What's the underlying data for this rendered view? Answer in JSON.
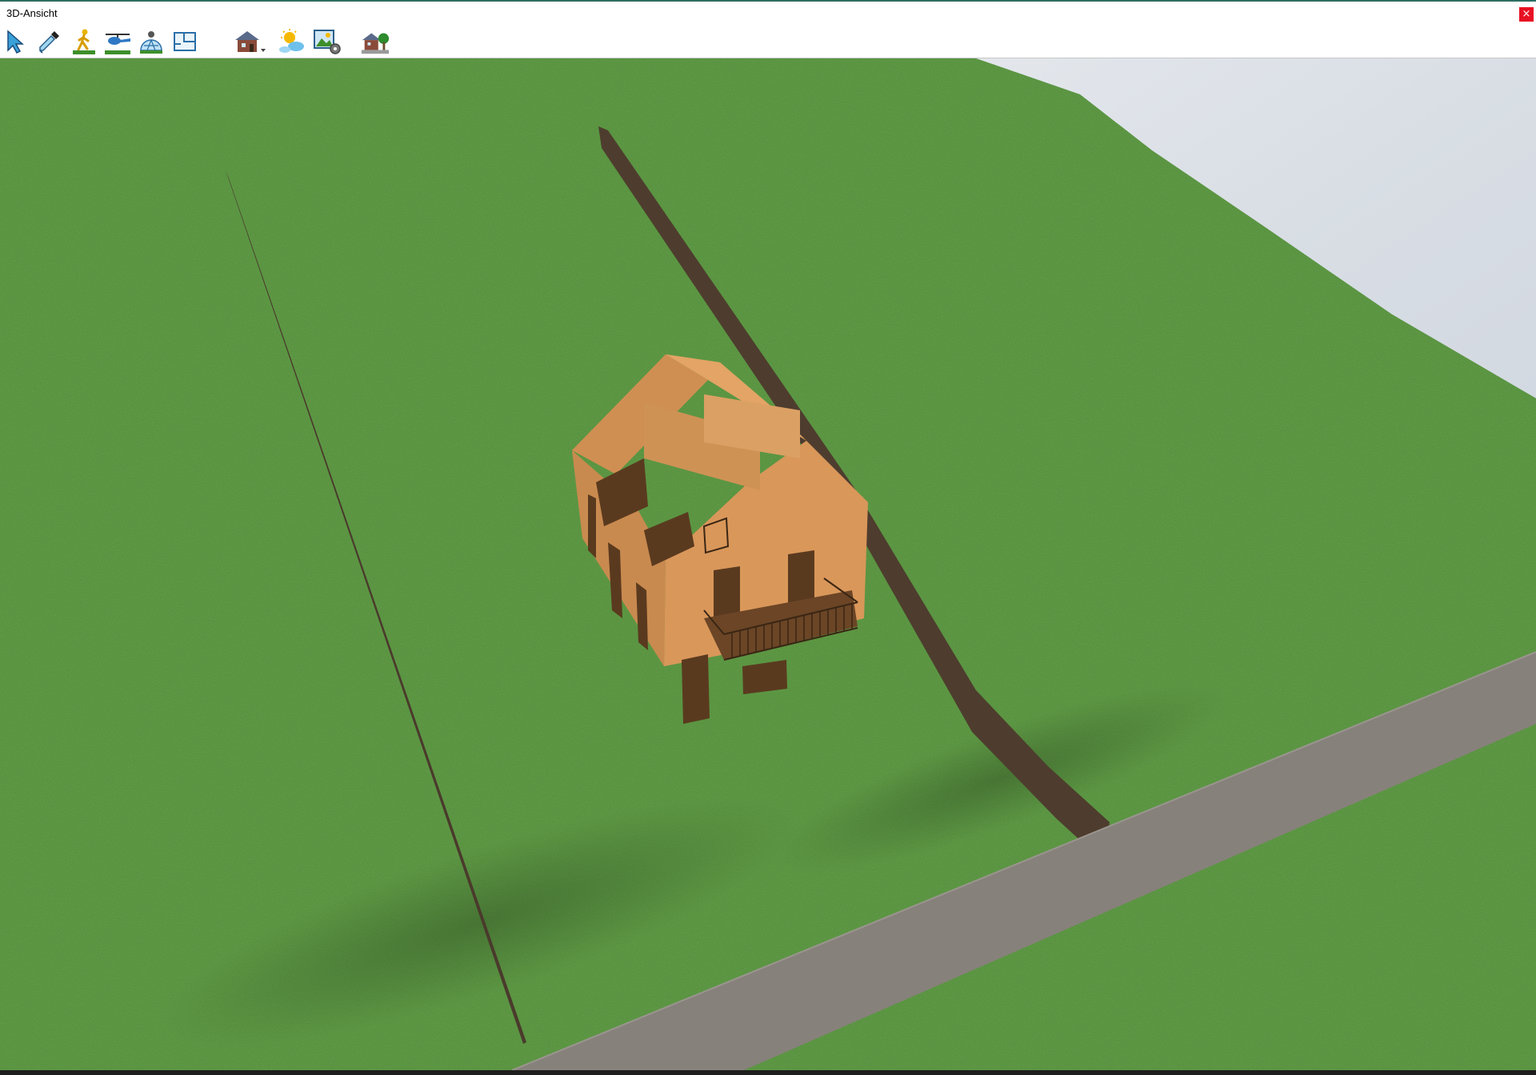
{
  "window": {
    "title": "3D-Ansicht",
    "close_glyph": "×"
  },
  "toolbar": {
    "buttons": [
      {
        "name": "select-tool-button",
        "icon": "select-arrow-icon"
      },
      {
        "name": "eyedropper-tool-button",
        "icon": "eyedropper-icon"
      },
      {
        "name": "walk-mode-button",
        "icon": "walking-person-icon"
      },
      {
        "name": "helicopter-mode-button",
        "icon": "helicopter-icon"
      },
      {
        "name": "orbit-mode-button",
        "icon": "orbit-dome-icon"
      },
      {
        "name": "floor-plan-view-button",
        "icon": "floor-plan-icon"
      },
      {
        "name": "building-view-button",
        "icon": "house-icon",
        "has_dropdown": true
      },
      {
        "name": "environment-weather-button",
        "icon": "sun-clouds-icon"
      },
      {
        "name": "render-settings-button",
        "icon": "picture-gear-icon"
      },
      {
        "name": "landscape-button",
        "icon": "house-tree-icon"
      }
    ]
  },
  "scene": {
    "grass_color": "#4f8a34",
    "sky_color": "#dfe4ea",
    "road_color": "#87817b",
    "house_color": "#d9975a",
    "wood_color": "#5a3a1f",
    "fence_color": "#4a3a2c"
  }
}
